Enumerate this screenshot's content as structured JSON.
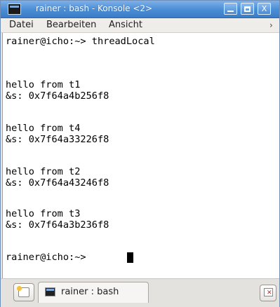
{
  "window": {
    "title": "rainer : bash - Konsole <2>",
    "close_glyph": "X"
  },
  "menu": {
    "items": [
      "Datei",
      "Bearbeiten",
      "Ansicht"
    ],
    "overflow": "›"
  },
  "terminal": {
    "lines": [
      "rainer@icho:~> threadLocal",
      "",
      "hello from t1",
      "&s: 0x7f64a4b256f8",
      "",
      "hello from t4",
      "&s: 0x7f64a33226f8",
      "",
      "hello from t2",
      "&s: 0x7f64a43246f8",
      "",
      "hello from t3",
      "&s: 0x7f64a3b236f8",
      "",
      "rainer@icho:~> "
    ]
  },
  "tabs": [
    {
      "label": "rainer : bash"
    }
  ],
  "colors": {
    "titlebar": "#4d8fd6",
    "terminal_bg": "#ffffff",
    "terminal_fg": "#000000"
  },
  "icons": {
    "app": "terminal-icon",
    "new_tab": "new-tab-icon",
    "close_tab": "close-tab-icon"
  }
}
